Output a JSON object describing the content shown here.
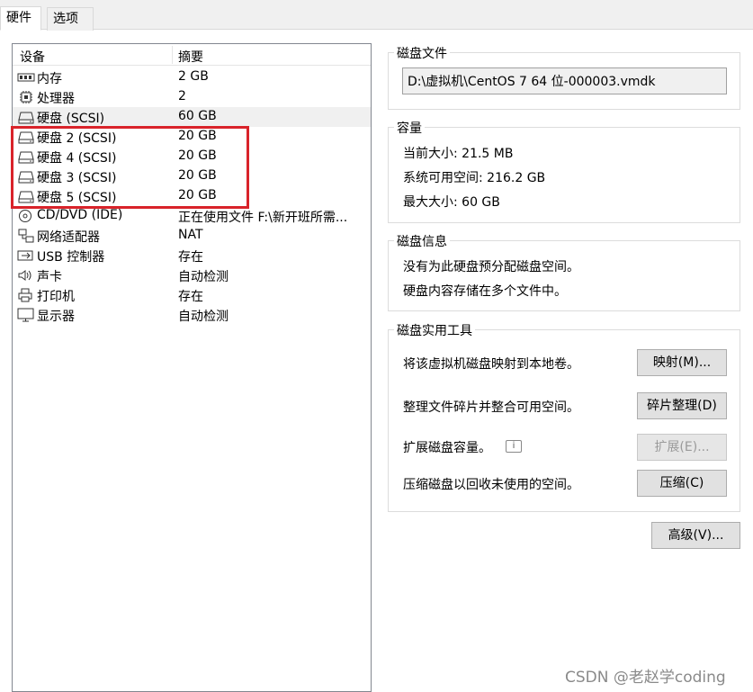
{
  "tabs": {
    "hardware": "硬件",
    "options": "选项"
  },
  "device_list": {
    "col_device": "设备",
    "col_summary": "摘要",
    "rows": [
      {
        "name": "内存",
        "summary": "2 GB",
        "icon": "memory-icon"
      },
      {
        "name": "处理器",
        "summary": "2",
        "icon": "processor-icon"
      },
      {
        "name": "硬盘 (SCSI)",
        "summary": "60 GB",
        "icon": "harddisk-icon",
        "selected": true
      },
      {
        "name": "硬盘 2 (SCSI)",
        "summary": "20 GB",
        "icon": "harddisk-icon"
      },
      {
        "name": "硬盘 4 (SCSI)",
        "summary": "20 GB",
        "icon": "harddisk-icon"
      },
      {
        "name": "硬盘 3 (SCSI)",
        "summary": "20 GB",
        "icon": "harddisk-icon"
      },
      {
        "name": "硬盘 5 (SCSI)",
        "summary": "20 GB",
        "icon": "harddisk-icon"
      },
      {
        "name": "CD/DVD (IDE)",
        "summary": "正在使用文件 F:\\新开班所需...",
        "icon": "cd-dvd-icon"
      },
      {
        "name": "网络适配器",
        "summary": "NAT",
        "icon": "network-adapter-icon"
      },
      {
        "name": "USB 控制器",
        "summary": "存在",
        "icon": "usb-icon"
      },
      {
        "name": "声卡",
        "summary": "自动检测",
        "icon": "speaker-icon"
      },
      {
        "name": "打印机",
        "summary": "存在",
        "icon": "printer-icon"
      },
      {
        "name": "显示器",
        "summary": "自动检测",
        "icon": "monitor-icon"
      }
    ]
  },
  "disk_file": {
    "title": "磁盘文件",
    "path": "D:\\虚拟机\\CentOS 7 64 位-000003.vmdk"
  },
  "capacity": {
    "title": "容量",
    "current_size": "当前大小: 21.5 MB",
    "system_free": "系统可用空间: 216.2 GB",
    "max_size": "最大大小: 60 GB"
  },
  "disk_info": {
    "title": "磁盘信息",
    "line1": "没有为此硬盘预分配磁盘空间。",
    "line2": "硬盘内容存储在多个文件中。"
  },
  "utilities": {
    "title": "磁盘实用工具",
    "map_text": "将该虚拟机磁盘映射到本地卷。",
    "map_button": "映射(M)...",
    "defrag_text": "整理文件碎片并整合可用空间。",
    "defrag_button": "碎片整理(D)",
    "expand_text": "扩展磁盘容量。",
    "expand_button": "扩展(E)...",
    "compact_text": "压缩磁盘以回收未使用的空间。",
    "compact_button": "压缩(C)"
  },
  "advanced_button": "高级(V)...",
  "watermark": "CSDN @老赵学coding"
}
